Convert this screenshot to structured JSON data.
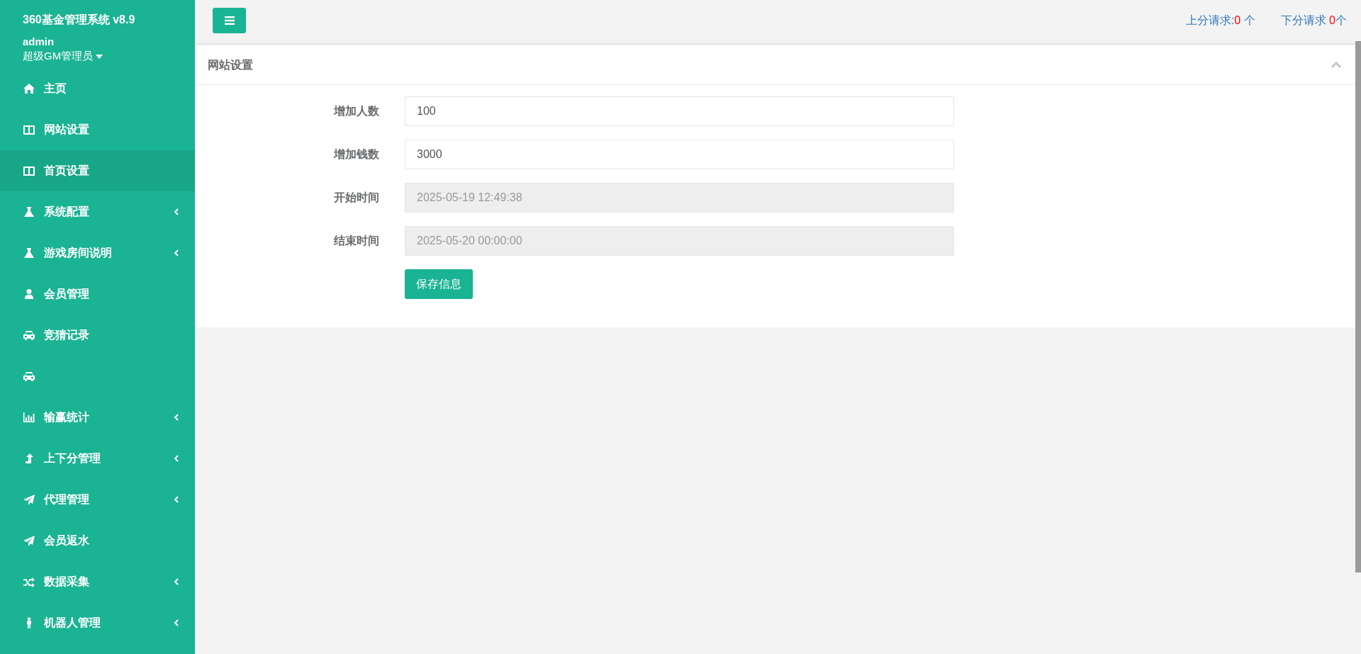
{
  "sidebar": {
    "brand": "360基金管理系统 v8.9",
    "user": "admin",
    "role": "超级GM管理员",
    "items": [
      {
        "kind": "home",
        "label": "主页",
        "submenu": false,
        "selected": false
      },
      {
        "kind": "columns",
        "label": "网站设置",
        "submenu": false,
        "selected": false
      },
      {
        "kind": "columns",
        "label": "首页设置",
        "submenu": false,
        "selected": true
      },
      {
        "kind": "flask",
        "label": "系统配置",
        "submenu": true,
        "selected": false
      },
      {
        "kind": "flask",
        "label": "游戏房间说明",
        "submenu": true,
        "selected": false
      },
      {
        "kind": "user",
        "label": "会员管理",
        "submenu": false,
        "selected": false
      },
      {
        "kind": "car",
        "label": "竞猜记录",
        "submenu": false,
        "selected": false
      },
      {
        "kind": "car",
        "submenu": false,
        "selected": false
      },
      {
        "kind": "chart",
        "label": "输赢统计",
        "submenu": true,
        "selected": false
      },
      {
        "kind": "arrow",
        "label": "上下分管理",
        "submenu": true,
        "selected": false
      },
      {
        "kind": "plane",
        "label": "代理管理",
        "submenu": true,
        "selected": false
      },
      {
        "kind": "plane",
        "label": "会员返水",
        "submenu": false,
        "selected": false
      },
      {
        "kind": "shuffle",
        "label": "数据采集",
        "submenu": true,
        "selected": false
      },
      {
        "kind": "person",
        "label": "机器人管理",
        "submenu": true,
        "selected": false
      }
    ]
  },
  "topbar": {
    "requests": [
      {
        "label": "上分请求:",
        "count": "0",
        "unit": " 个"
      },
      {
        "label": "下分请求 ",
        "count": "0",
        "unit": "个"
      }
    ]
  },
  "panel": {
    "title": "网站设置",
    "fields": [
      {
        "label": "增加人数",
        "value": "100",
        "disabled": false
      },
      {
        "label": "增加钱数",
        "value": "3000",
        "disabled": false
      },
      {
        "label": "开始时间",
        "value": "2025-05-19 12:49:38",
        "disabled": true
      },
      {
        "label": "结束时间",
        "value": "2025-05-20 00:00:00",
        "disabled": true
      }
    ],
    "button": "保存信息"
  }
}
